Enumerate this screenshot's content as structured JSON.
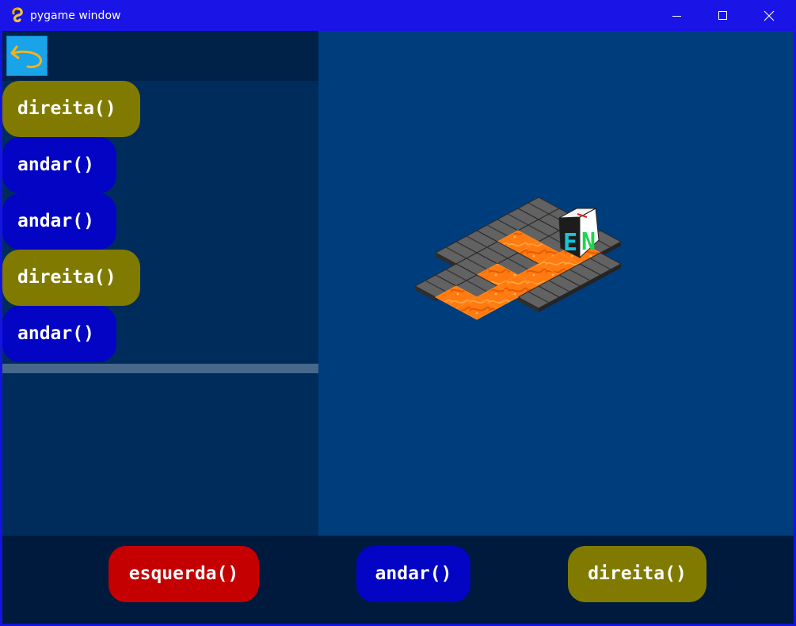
{
  "window": {
    "title": "pygame window",
    "icons": {
      "app": "pygame-snake-icon",
      "minimize": "minimize-icon",
      "maximize": "maximize-icon",
      "close": "close-icon"
    }
  },
  "code_panel": {
    "back_icon": "undo-arrow-icon",
    "program": [
      {
        "label": "direita()",
        "kind": "turn"
      },
      {
        "label": "andar()",
        "kind": "move"
      },
      {
        "label": "andar()",
        "kind": "move"
      },
      {
        "label": "direita()",
        "kind": "turn"
      },
      {
        "label": "andar()",
        "kind": "move"
      }
    ]
  },
  "board": {
    "robot_faces": [
      "E",
      "N"
    ],
    "tiles": [
      "stone",
      "lava"
    ]
  },
  "palette": {
    "left_label": "esquerda()",
    "move_label": "andar()",
    "right_label": "direita()"
  },
  "colors": {
    "turn": "#807b00",
    "move": "#0404c4",
    "left": "#c40000",
    "lava": "#ff7a10",
    "stone": "#5a5a5a",
    "game_bg": "#003d7c"
  }
}
